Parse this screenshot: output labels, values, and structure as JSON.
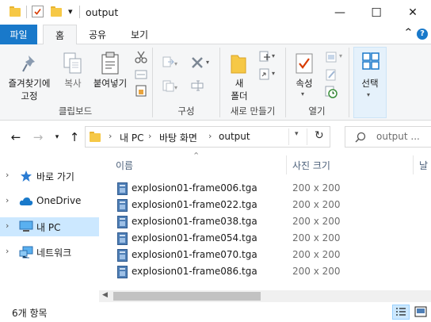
{
  "window": {
    "title": "output",
    "minimize_glyph": "—",
    "maximize_glyph": "☐",
    "close_glyph": "✕",
    "qat_dropdown_glyph": "▾"
  },
  "ribbon_tabs": {
    "file": "파일",
    "home": "홈",
    "share": "공유",
    "view": "보기"
  },
  "ribbon_right": {
    "collapse_glyph": "⌃",
    "help_glyph": "?"
  },
  "ribbon": {
    "pin_label": "즐겨찾기에\n고정",
    "copy_label": "복사",
    "paste_label": "붙여넣기",
    "clipboard_group": "클립보드",
    "organize_group": "구성",
    "new_folder_label": "새\n폴더",
    "new_group": "새로 만들기",
    "properties_label": "속성",
    "open_group": "열기",
    "select_label": "선택"
  },
  "address": {
    "crumbs": [
      "내 PC",
      "바탕 화면",
      "output"
    ],
    "crumb_sep": "›",
    "search_placeholder": "output ..."
  },
  "nav": {
    "items": [
      {
        "label": "바로 가기",
        "icon": "star-icon"
      },
      {
        "label": "OneDrive",
        "icon": "cloud-icon"
      },
      {
        "label": "내 PC",
        "icon": "pc-icon",
        "selected": true
      },
      {
        "label": "네트워크",
        "icon": "network-icon"
      }
    ]
  },
  "files": {
    "columns": {
      "name": "이름",
      "size": "사진 크기",
      "extra": "날"
    },
    "rows": [
      {
        "name": "explosion01-frame006.tga",
        "size": "200 x 200"
      },
      {
        "name": "explosion01-frame022.tga",
        "size": "200 x 200"
      },
      {
        "name": "explosion01-frame038.tga",
        "size": "200 x 200"
      },
      {
        "name": "explosion01-frame054.tga",
        "size": "200 x 200"
      },
      {
        "name": "explosion01-frame070.tga",
        "size": "200 x 200"
      },
      {
        "name": "explosion01-frame086.tga",
        "size": "200 x 200"
      }
    ]
  },
  "status": {
    "count": "6개 항목"
  },
  "colors": {
    "accent": "#1979ca",
    "selection": "#cce8ff",
    "folder": "#f6c846"
  }
}
